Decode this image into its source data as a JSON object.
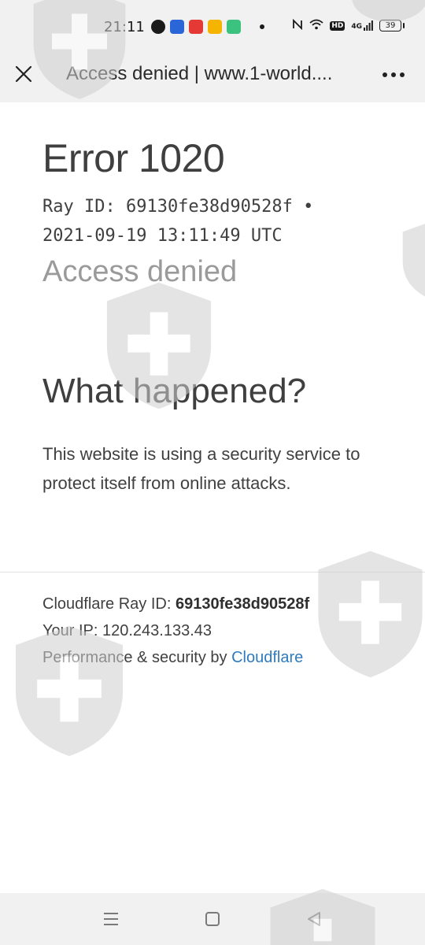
{
  "status_bar": {
    "time": "21:11",
    "network": "4G",
    "hd_label": "HD",
    "battery": "39"
  },
  "browser": {
    "title": "Access denied | www.1-world...."
  },
  "page": {
    "error_title": "Error 1020",
    "ray_line_1": "Ray ID: 69130fe38d90528f •",
    "ray_line_2": "2021-09-19 13:11:49 UTC",
    "access_denied": "Access denied",
    "what_happened": "What happened?",
    "description": "This website is using a security service to protect itself from online attacks.",
    "footer": {
      "ray_label": "Cloudflare Ray ID: ",
      "ray_value": "69130fe38d90528f",
      "ip_text": "Your IP: 120.243.133.43",
      "perf_text": "Performance & security by ",
      "cloudflare_link": "Cloudflare"
    }
  },
  "colors": {
    "link": "#2f7bbf",
    "muted": "#9a9a9a",
    "chrome": "#f1f1f1"
  },
  "icons": {
    "close": "close-icon",
    "more": "more-icon",
    "nav_menu": "menu-icon",
    "nav_home": "home-icon",
    "nav_back": "back-icon",
    "watermark": "shield-cross-icon"
  }
}
